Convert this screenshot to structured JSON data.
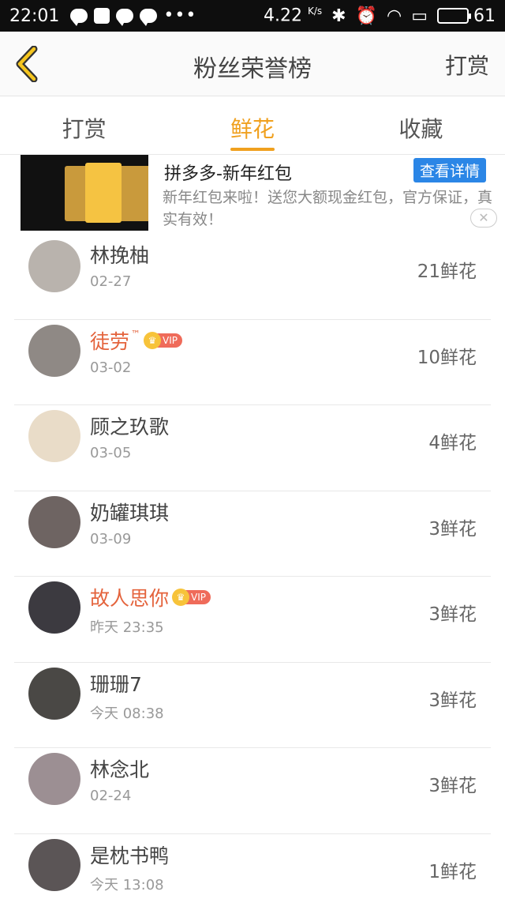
{
  "status_bar": {
    "time": "22:01",
    "speed": "4.22",
    "speed_unit": "K/s",
    "battery": "61"
  },
  "header": {
    "title": "粉丝荣誉榜",
    "action": "打赏"
  },
  "tabs": [
    {
      "label": "打赏",
      "active": false
    },
    {
      "label": "鲜花",
      "active": true
    },
    {
      "label": "收藏",
      "active": false
    }
  ],
  "ad": {
    "title": "拼多多-新年红包",
    "button": "查看详情",
    "description": "新年红包来啦！送您大额现金红包，官方保证，真实有效！"
  },
  "fans": [
    {
      "name": "林挽柚",
      "vip": false,
      "trademark": "",
      "date": "02-27",
      "count": "21鲜花",
      "avatar_color": "#b9b3ad"
    },
    {
      "name": "徒劳",
      "vip": true,
      "trademark": "™",
      "date": "03-02",
      "count": "10鲜花",
      "avatar_color": "#8f8985"
    },
    {
      "name": "顾之玖歌",
      "vip": false,
      "trademark": "",
      "date": "03-05",
      "count": "4鲜花",
      "avatar_color": "#e9dcc8"
    },
    {
      "name": "奶罐琪琪",
      "vip": false,
      "trademark": "",
      "date": "03-09",
      "count": "3鲜花",
      "avatar_color": "#6e6462"
    },
    {
      "name": "故人思你",
      "vip": true,
      "trademark": "",
      "date": "昨天 23:35",
      "count": "3鲜花",
      "avatar_color": "#3c3a40"
    },
    {
      "name": "珊珊7",
      "vip": false,
      "trademark": "",
      "date": "今天 08:38",
      "count": "3鲜花",
      "avatar_color": "#4a4845"
    },
    {
      "name": "林念北",
      "vip": false,
      "trademark": "",
      "date": "02-24",
      "count": "3鲜花",
      "avatar_color": "#9c8f93"
    },
    {
      "name": "是枕书鸭",
      "vip": false,
      "trademark": "",
      "date": "今天 13:08",
      "count": "1鲜花",
      "avatar_color": "#5b5556"
    }
  ],
  "vip_label": "VIP",
  "colors": {
    "accent": "#f0a01e",
    "vip_name": "#e4633c",
    "ad_button": "#2b86e6"
  }
}
